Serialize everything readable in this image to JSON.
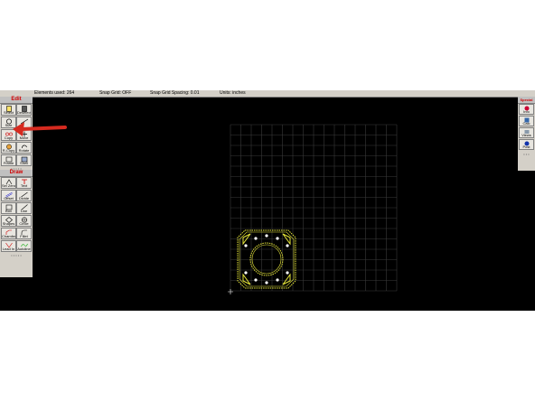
{
  "status": {
    "elements": "Elements used: 264",
    "snap_grid": "Snap Grid: OFF",
    "snap_spacing": "Snap Grid Spacing: 0.01",
    "units": "Units: inches"
  },
  "left_toolbar": {
    "edit_header": "Edit",
    "draw_header": "Draw",
    "edit_tools": [
      "Select",
      "Deselect",
      "Size",
      "",
      "Copy",
      "Move",
      "R-Copy",
      "Rotate",
      "Frame",
      "Shell"
    ],
    "draw_tools": [
      "Sel Zero",
      "Text",
      "Offset",
      "Divide",
      "Box",
      "Line",
      "Shapes",
      "Circle",
      "Chamfer",
      "Fillet",
      "Lead In",
      "Autoline"
    ]
  },
  "right_toolbar": {
    "header": "Special",
    "tools": [
      "Info",
      "Calc",
      "Views",
      "Post"
    ]
  },
  "colors": {
    "background": "#000000",
    "grid": "#3a3a3a",
    "part_outline": "#e8e83a",
    "annotation_arrow": "#d62a1f",
    "edit_header": "#d00000"
  }
}
